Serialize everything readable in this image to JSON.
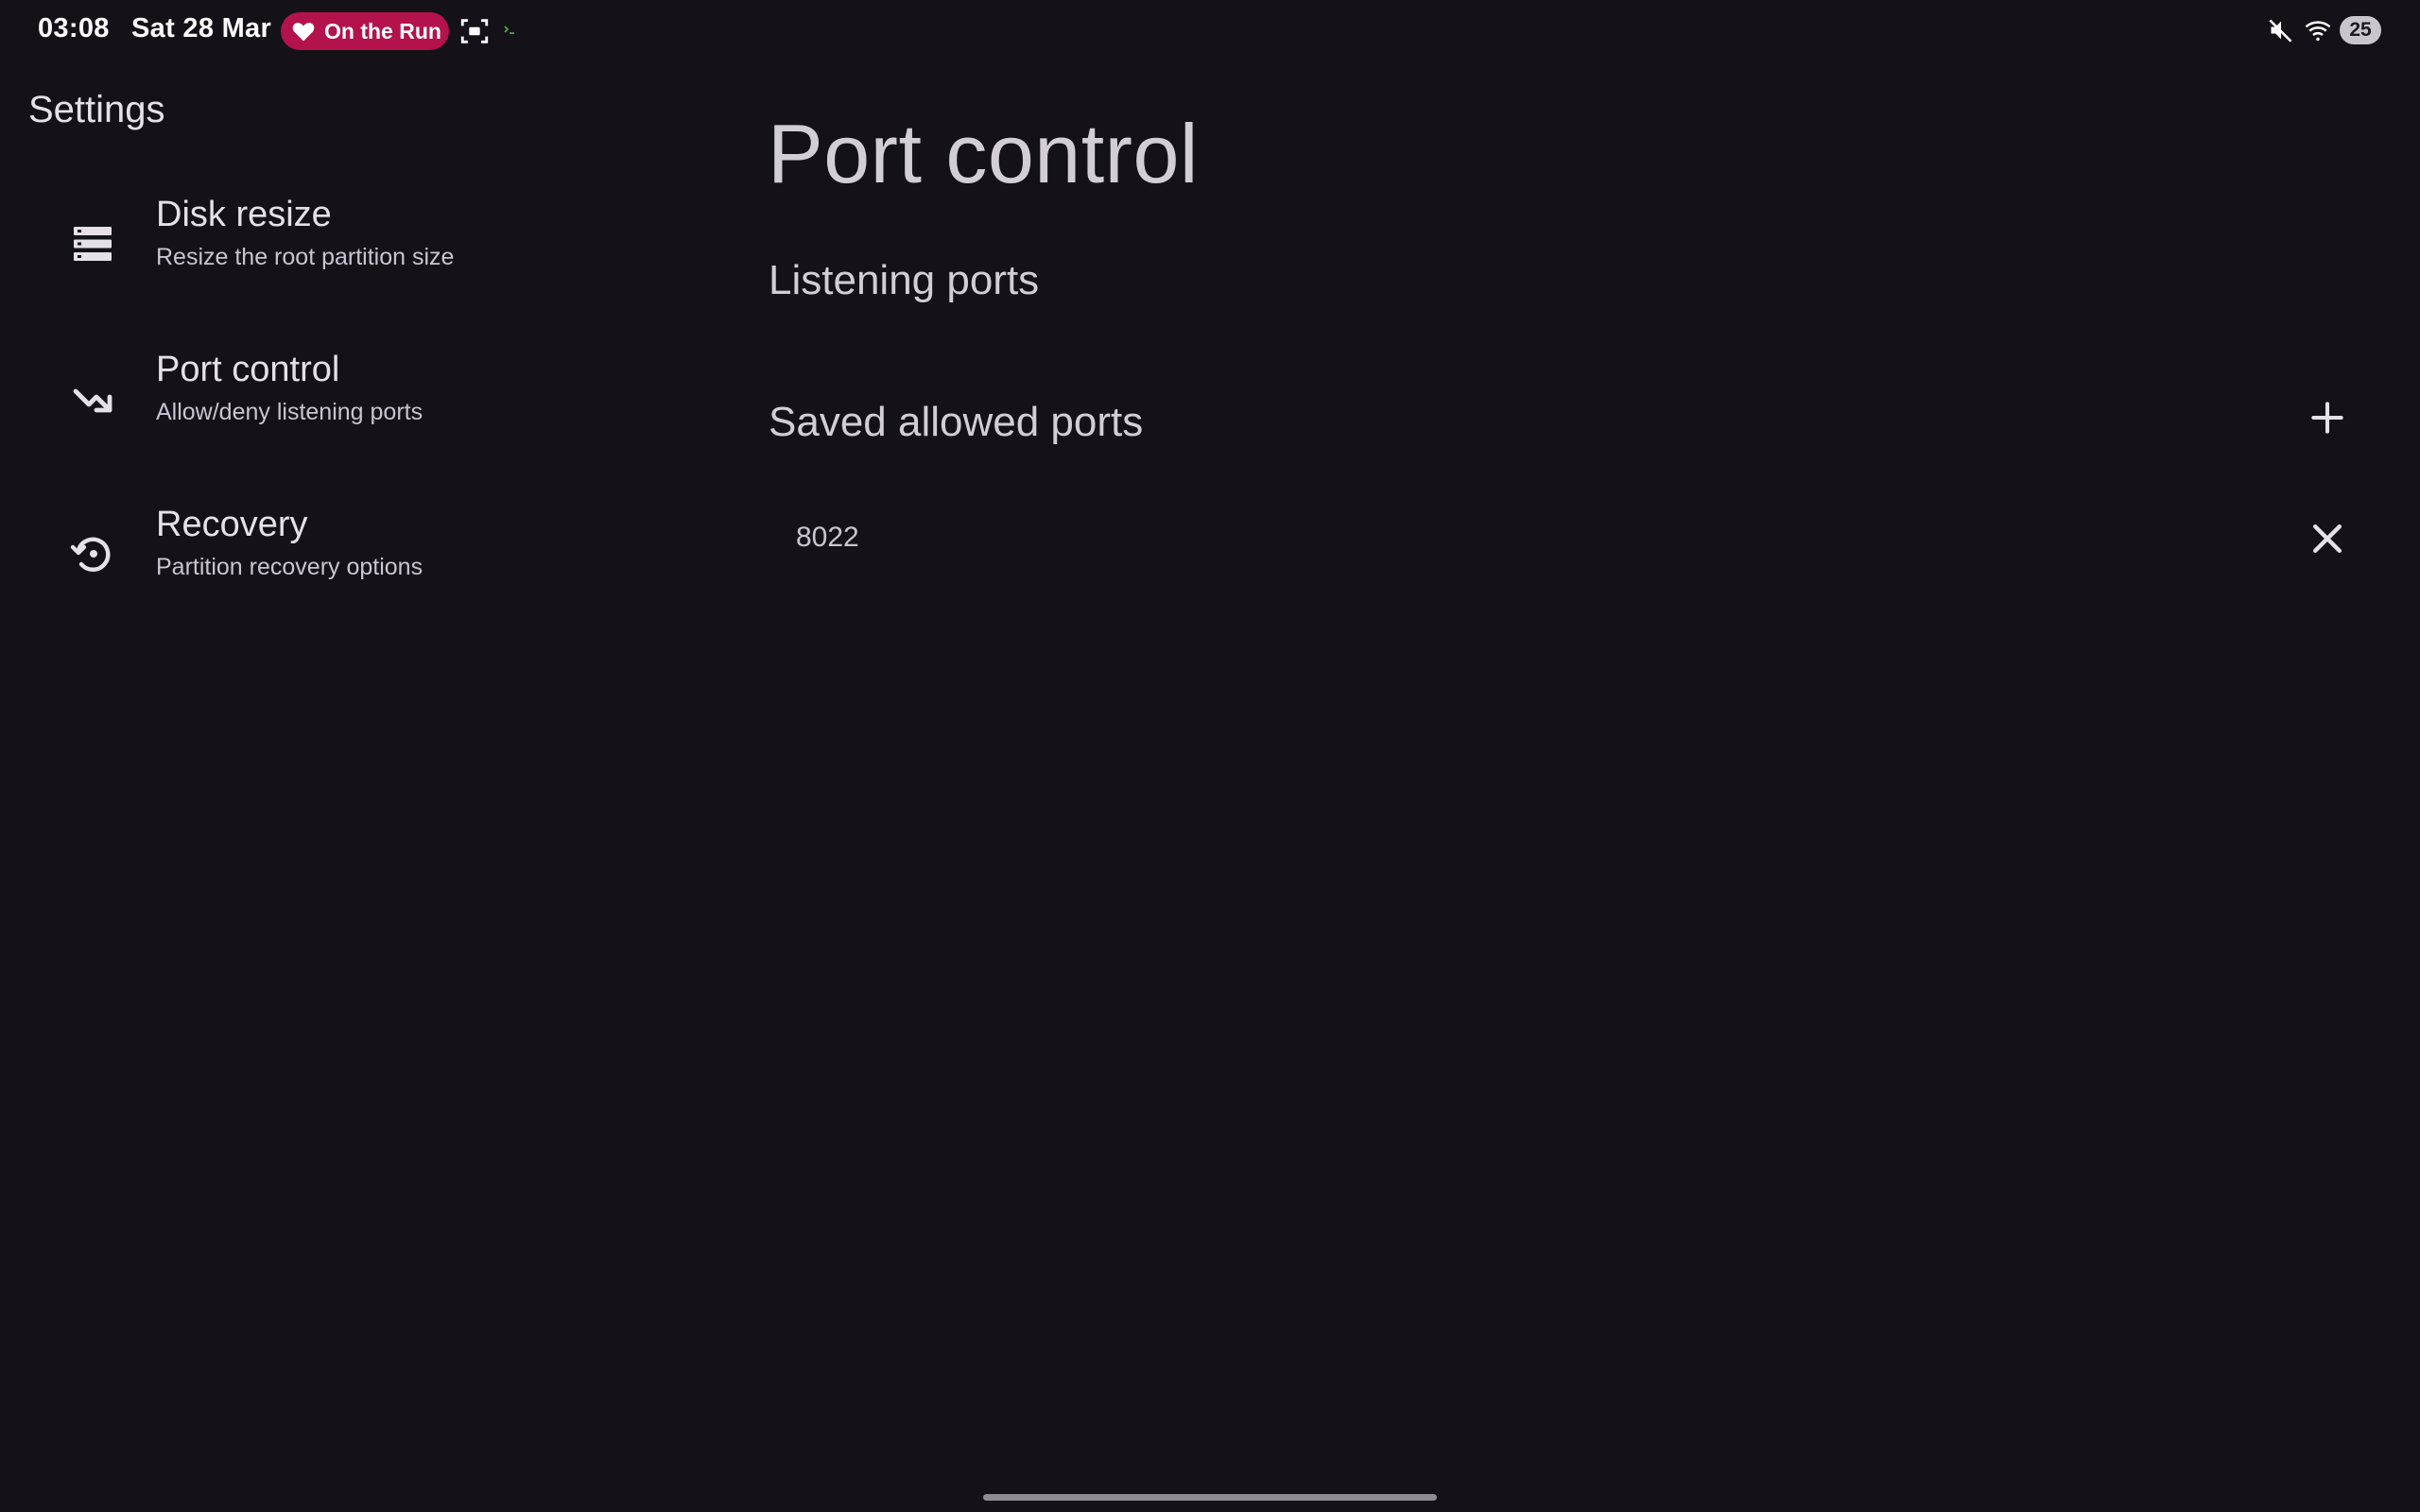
{
  "status_bar": {
    "time": "03:08",
    "date": "Sat 28 Mar",
    "chip_label": "On the Run",
    "chip_color": "#b3124c",
    "battery": "25",
    "icons": [
      "heart-icon",
      "screenshot-icon",
      "terminal-icon",
      "mute-icon",
      "wifi-icon",
      "battery-icon"
    ]
  },
  "sidebar": {
    "title": "Settings",
    "items": [
      {
        "title": "Disk resize",
        "subtitle": "Resize the root partition size",
        "icon": "storage-icon"
      },
      {
        "title": "Port control",
        "subtitle": "Allow/deny listening ports",
        "icon": "trending-arrow-icon"
      },
      {
        "title": "Recovery",
        "subtitle": "Partition recovery options",
        "icon": "restore-icon"
      }
    ]
  },
  "main": {
    "title": "Port control",
    "listening_heading": "Listening ports",
    "saved_heading": "Saved allowed ports",
    "saved_ports": [
      "8022"
    ]
  },
  "colors": {
    "background": "#141218",
    "text_primary": "#e6e0e9",
    "text_secondary": "#cac4d0"
  }
}
